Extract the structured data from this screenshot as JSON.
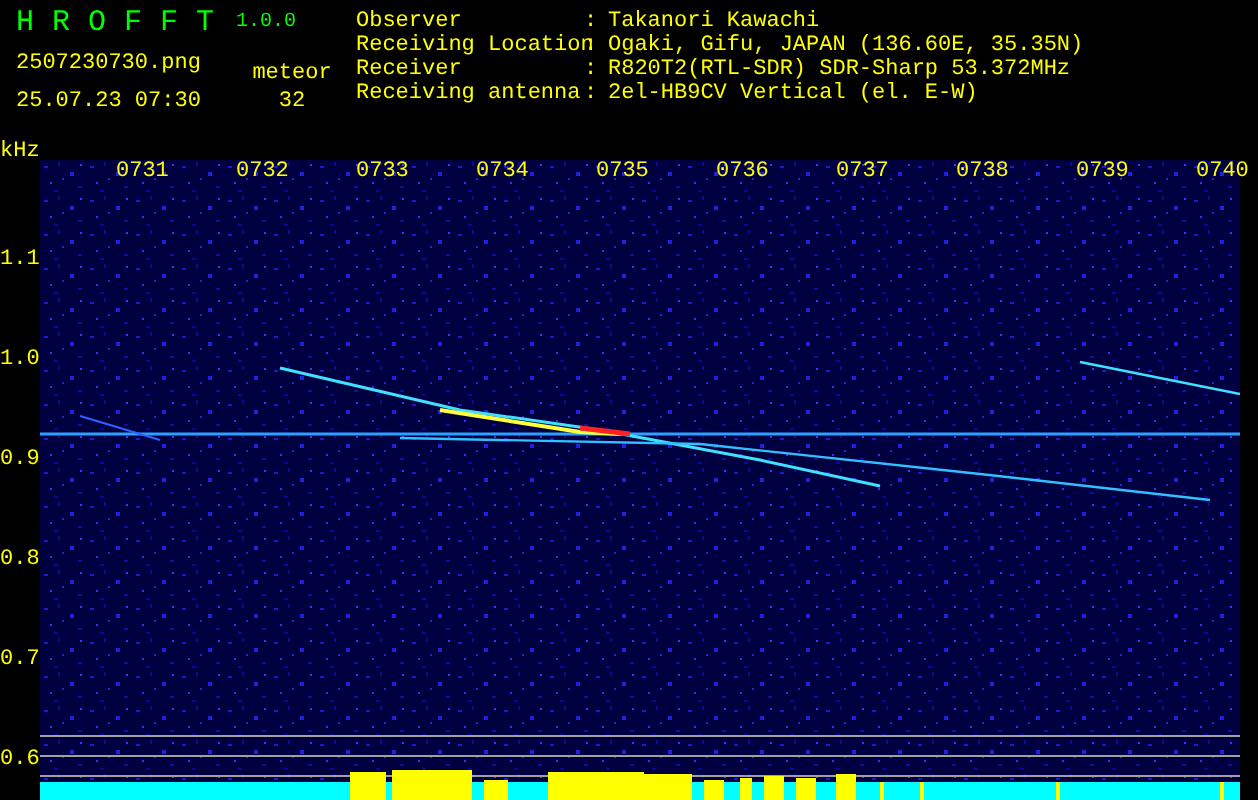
{
  "app": {
    "title": "H R O F F T",
    "version": "1.0.0",
    "filename": "2507230730.png",
    "datetime": "25.07.23 07:30"
  },
  "meteor": {
    "label": "meteor",
    "count": "32"
  },
  "info": [
    {
      "label": "Observer",
      "separator": ":",
      "value": "Takanori Kawachi"
    },
    {
      "label": "Receiving Location",
      "separator": ":",
      "value": "Ogaki, Gifu, JAPAN (136.60E, 35.35N)"
    },
    {
      "label": "Receiver",
      "separator": ":",
      "value": "R820T2(RTL-SDR) SDR-Sharp 53.372MHz"
    },
    {
      "label": "Receiving antenna",
      "separator": ":",
      "value": "2el-HB9CV Vertical (el. E-W)"
    }
  ],
  "spectrogram": {
    "y_unit": "kHz",
    "y_labels": [
      "1.1",
      "1.0",
      "0.9",
      "0.8",
      "0.7",
      "0.6"
    ],
    "time_labels": [
      "0731",
      "0732",
      "0733",
      "0734",
      "0735",
      "0736",
      "0737",
      "0738",
      "0739",
      "0740"
    ]
  }
}
